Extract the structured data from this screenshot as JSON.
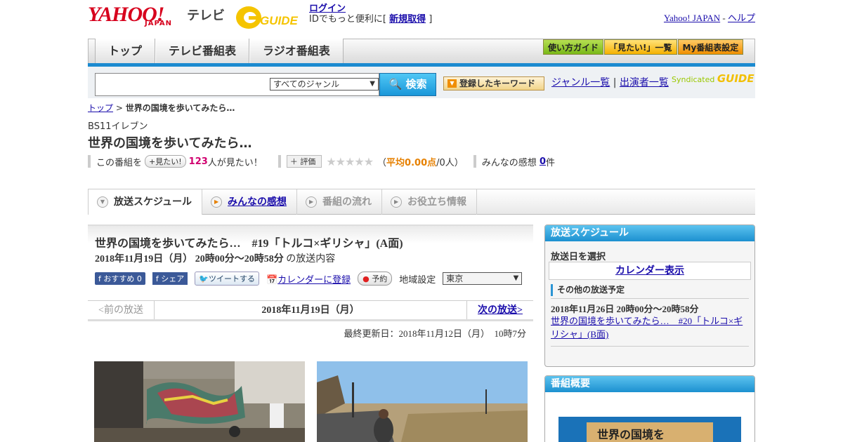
{
  "header": {
    "yahoo": "YAHOO!",
    "japan": "JAPAN",
    "tv": "テレビ",
    "gguide": "GUIDE",
    "login": "ログイン",
    "id_text": "IDでもっと便利に[",
    "signup": "新規取得",
    "id_close": "]",
    "yahoo_japan": "Yahoo! JAPAN",
    "dash": "-",
    "help": "ヘルプ"
  },
  "nav": {
    "tabs": [
      "トップ",
      "テレビ番組表",
      "ラジオ番組表"
    ],
    "buttons": [
      "使い方ガイド",
      "「見たい!」一覧",
      "My番組表設定"
    ]
  },
  "search": {
    "genre": "すべてのジャンル",
    "button": "検索",
    "keyword": "登録したキーワード",
    "genre_list": "ジャンル一覧",
    "divider": "|",
    "cast_list": "出演者一覧",
    "syndicated": "Syndicated"
  },
  "breadcrumb": {
    "top": "トップ",
    "sep": ">",
    "current": "世界の国境を歩いてみたら…"
  },
  "program": {
    "channel": "BS11イレブン",
    "title": "世界の国境を歩いてみたら…",
    "mitai_prefix": "この番組を",
    "mitai_btn": "見たい!",
    "mitai_count": "123",
    "mitai_suffix": "人が見たい！",
    "hyouka": "評価",
    "stars": "★★★★★",
    "avg_open": "（",
    "avg": "平均0.00点",
    "avg_rest": "/0人）",
    "kansou": "みんなの感想",
    "kansou_count": "0",
    "kansou_unit": "件"
  },
  "content_tabs": [
    "放送スケジュール",
    "みんなの感想",
    "番組の流れ",
    "お役立ち情報"
  ],
  "episode": {
    "title": "世界の国境を歩いてみたら…　#19「トルコ×ギリシャ」(A面)",
    "date": "2018年11月19日（月）  20時00分～20時58分",
    "date_suffix": "の放送内容",
    "fb_recommend": "おすすめ 0",
    "fb_share": "シェア",
    "tweet": "ツイートする",
    "calendar": "カレンダーに登録",
    "reserve": "予約",
    "region_label": "地域設定",
    "region": "東京",
    "prev": "<前の放送",
    "current": "2018年11月19日（月）",
    "next": "次の放送>",
    "updated": "最終更新日：2018年11月12日（月）　10時7分"
  },
  "sidebar": {
    "schedule_head": "放送スケジュール",
    "select_date": "放送日を選択",
    "calendar": "カレンダー表示",
    "other_head": "その他の放送予定",
    "other_date": "2018年11月26日  20時00分～20時58分",
    "other_link": "世界の国境を歩いてみたら…　#20「トルコ×ギリシャ」(B面)",
    "overview_head": "番組概要",
    "overview_img_text": "世界の国境を"
  }
}
